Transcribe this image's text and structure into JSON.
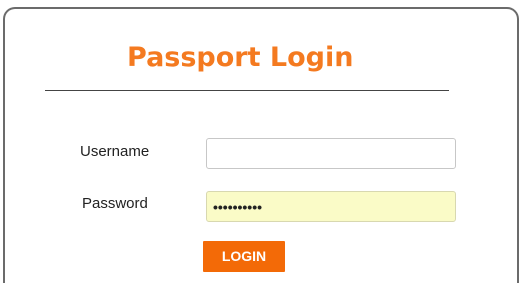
{
  "login": {
    "title": "Passport Login",
    "username_label": "Username",
    "username_value": "",
    "password_label": "Password",
    "password_value": "secret1234",
    "button_label": "LOGIN"
  },
  "colors": {
    "accent": "#f47a20",
    "button_bg": "#f36a07",
    "password_bg": "#fafbc7",
    "border": "#6b6b6b"
  }
}
